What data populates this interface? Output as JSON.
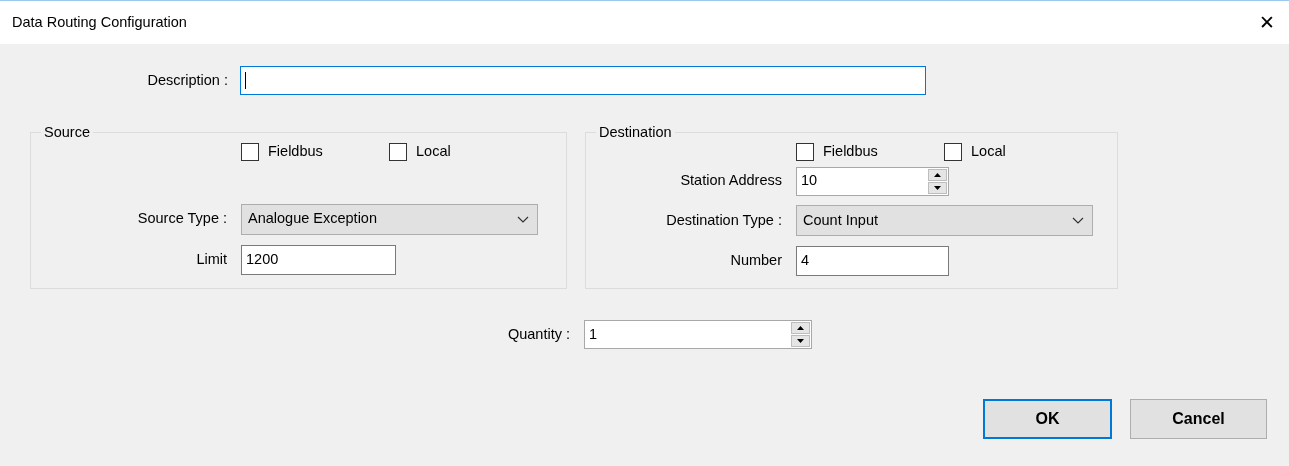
{
  "window": {
    "title": "Data Routing Configuration",
    "close": "✕"
  },
  "description": {
    "label": "Description :",
    "focused": true
  },
  "groups": [
    {
      "title": "Source",
      "checkboxes": [
        {
          "label": "Fieldbus",
          "checked": false
        },
        {
          "label": "Local",
          "checked": false
        }
      ],
      "fields": [
        {
          "kind": "dropdown",
          "label": "Source Type :",
          "value": "Analogue Exception"
        },
        {
          "kind": "text",
          "label": "Limit",
          "value": "1200"
        }
      ]
    },
    {
      "title": "Destination",
      "checkboxes": [
        {
          "label": "Fieldbus",
          "checked": false
        },
        {
          "label": "Local",
          "checked": false
        }
      ],
      "fields": [
        {
          "kind": "spinner",
          "label": "Station Address",
          "value": "10"
        },
        {
          "kind": "dropdown",
          "label": "Destination Type :",
          "value": "Count Input"
        },
        {
          "kind": "text",
          "label": "Number",
          "value": "4"
        }
      ]
    }
  ],
  "quantity": {
    "label": "Quantity :",
    "value": "1"
  },
  "buttons": [
    {
      "label": "OK",
      "default": true
    },
    {
      "label": "Cancel",
      "default": false
    }
  ]
}
